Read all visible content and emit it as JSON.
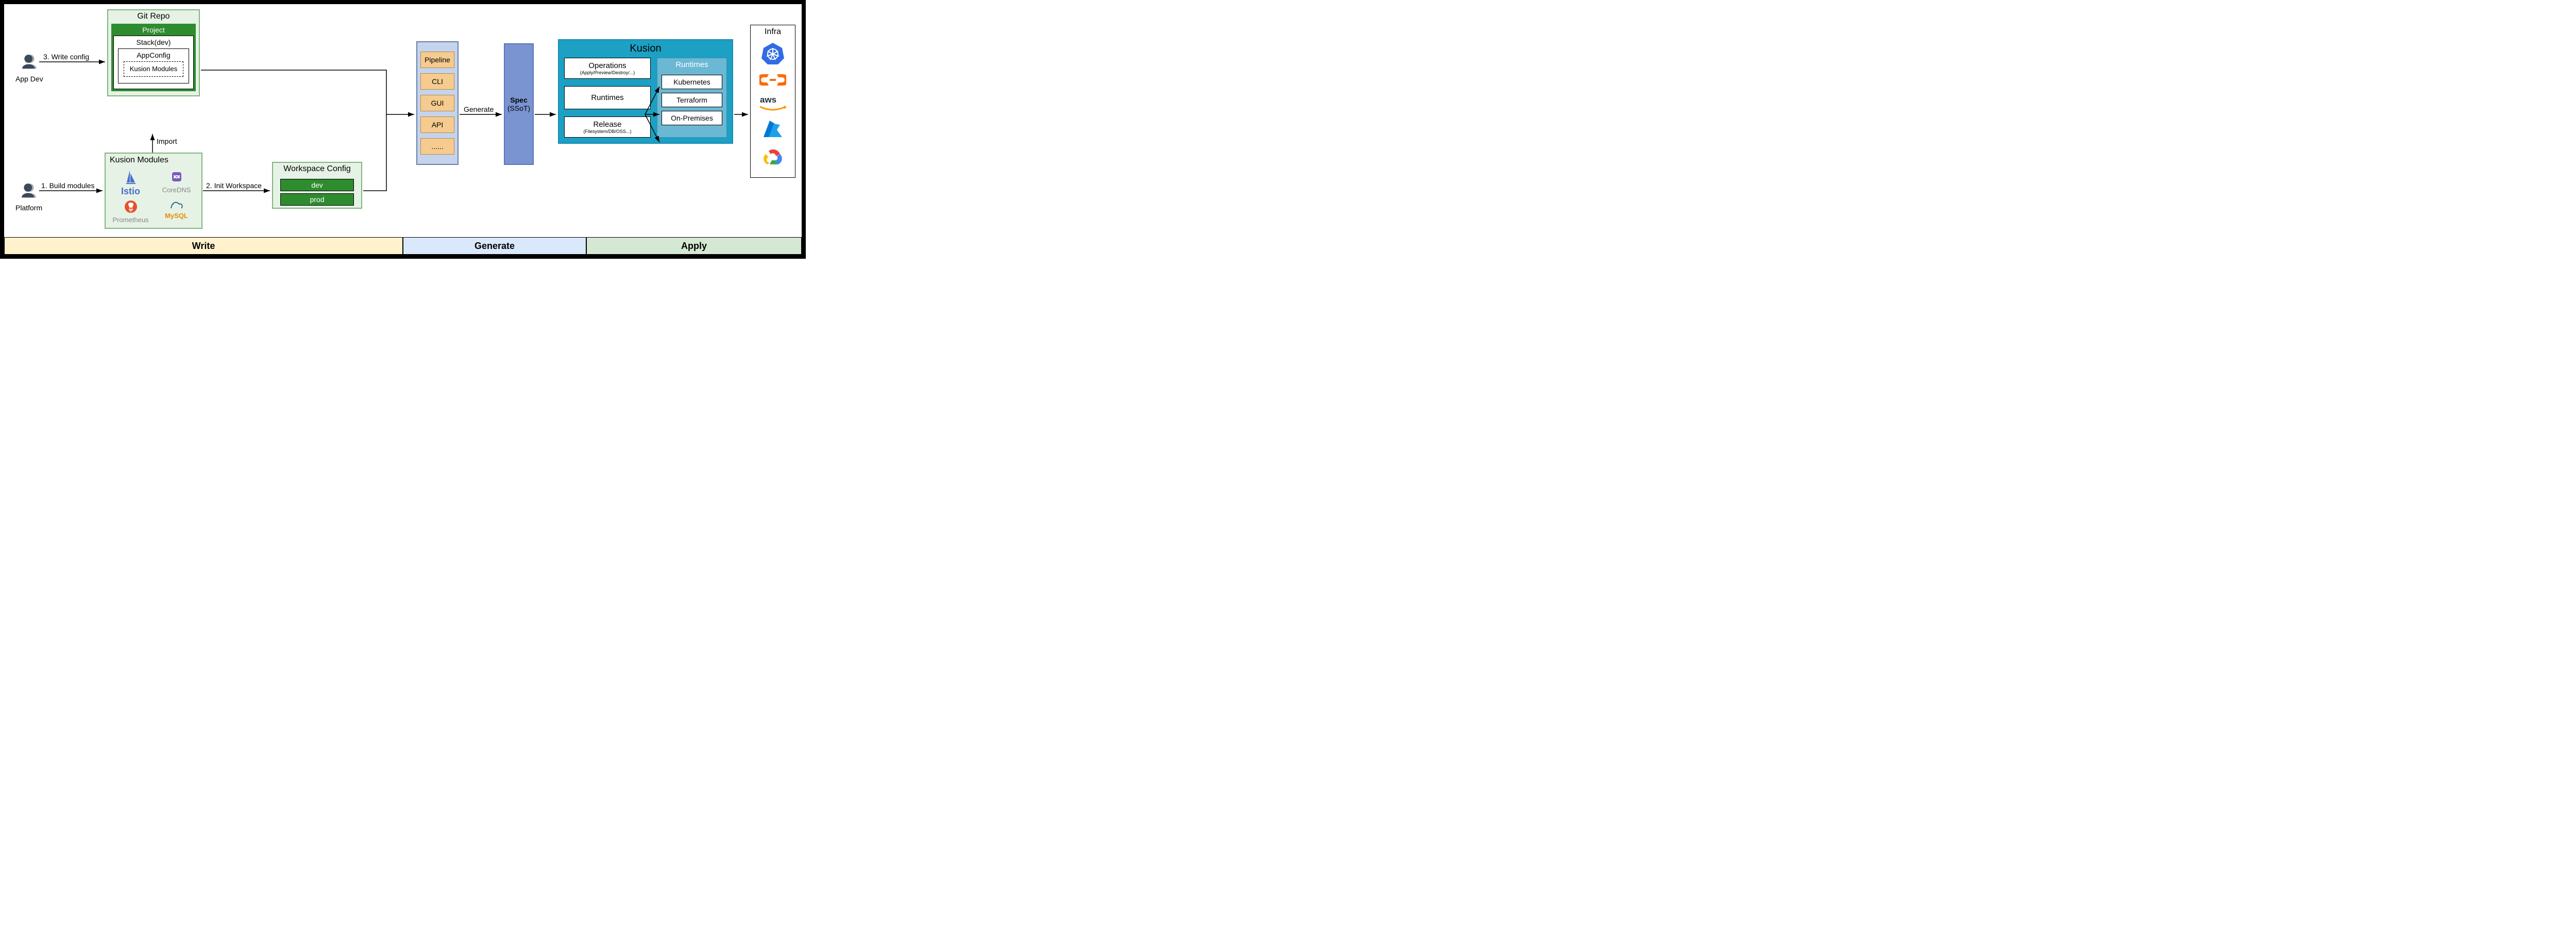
{
  "phases": {
    "write": "Write",
    "generate": "Generate",
    "apply": "Apply"
  },
  "actors": {
    "app_dev": "App Dev",
    "platform": "Platform"
  },
  "arrow_labels": {
    "write_config": "3. Write config",
    "build_modules": "1. Build modules",
    "import": "Import",
    "init_workspace": "2. Init Workspace",
    "generate": "Generate"
  },
  "git_repo": {
    "title": "Git Repo",
    "project": "Project",
    "stack": "Stack(dev)",
    "appconfig": "AppConfig",
    "kusion_modules": "Kusion Modules"
  },
  "kusion_modules_box": {
    "title": "Kusion Modules",
    "logos": {
      "istio": "Istio",
      "coredns": "CoreDNS",
      "prometheus": "Prometheus",
      "mysql": "MySQL"
    }
  },
  "workspace_config": {
    "title": "Workspace Config",
    "envs": [
      "dev",
      "prod"
    ]
  },
  "clients": [
    "Pipeline",
    "CLI",
    "GUI",
    "API",
    "......"
  ],
  "spec": {
    "line1": "Spec",
    "line2": "(SSoT)"
  },
  "kusion": {
    "title": "Kusion",
    "operations": {
      "label": "Operations",
      "sub": "(Apply/Preview/Destroy/...)"
    },
    "runtimes_btn": "Runtimes",
    "release": {
      "label": "Release",
      "sub": "(Filesystem/DB/OSS...)"
    },
    "runtimes_panel": {
      "title": "Runtimes",
      "items": [
        "Kubernetes",
        "Terraform",
        "On-Premises"
      ]
    }
  },
  "infra": {
    "title": "Infra",
    "providers": [
      "kubernetes-icon",
      "alibaba-cloud-icon",
      "aws-icon",
      "azure-icon",
      "gcp-icon"
    ]
  }
}
